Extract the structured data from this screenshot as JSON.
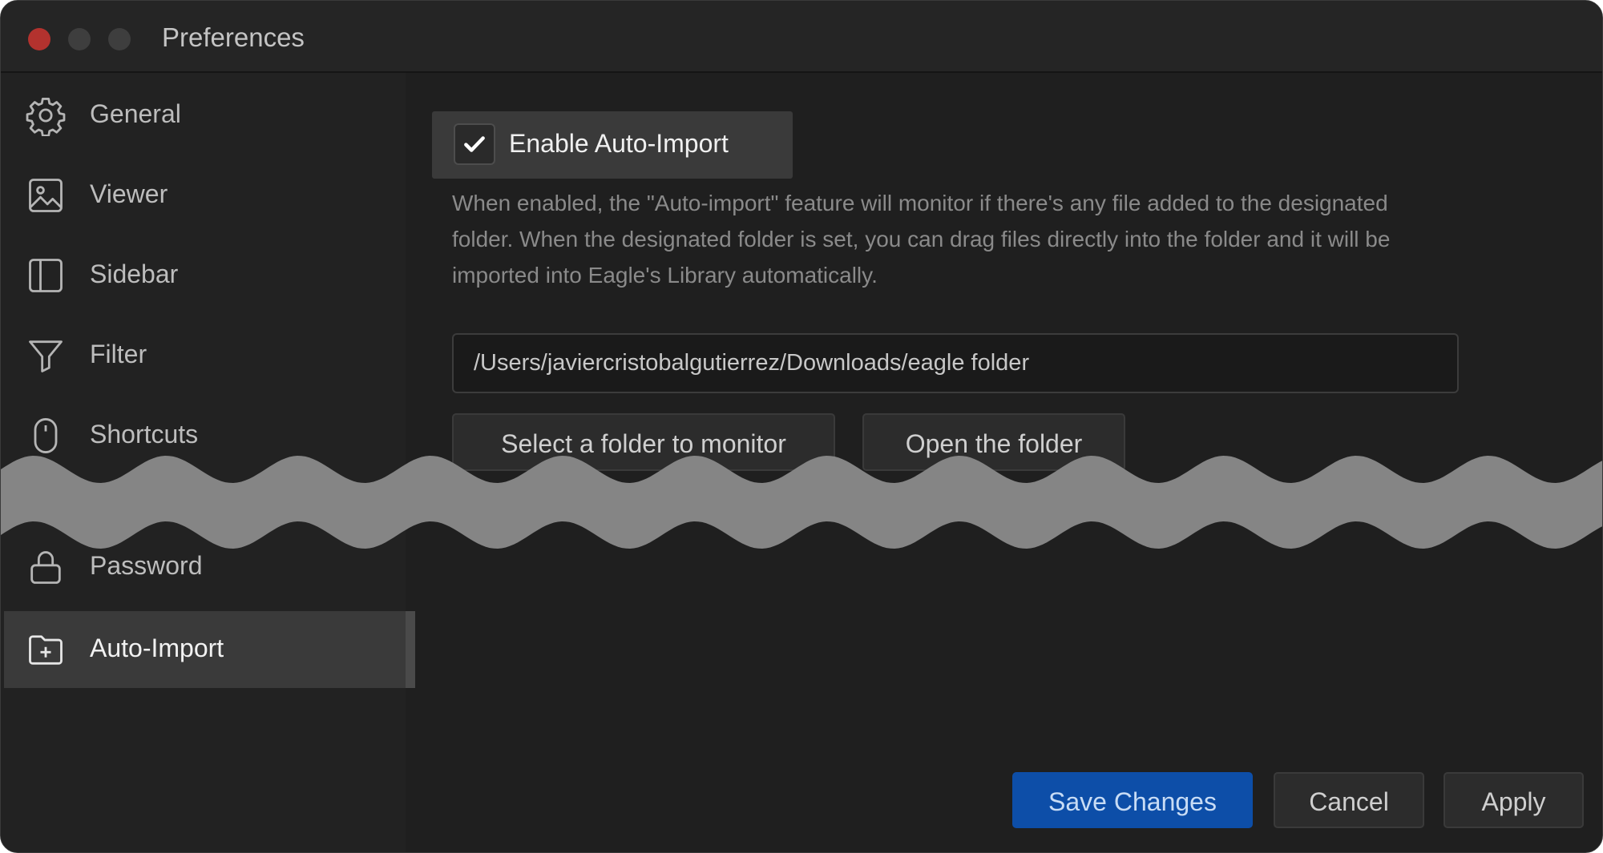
{
  "window": {
    "title": "Preferences"
  },
  "sidebar": {
    "items": [
      {
        "label": "General",
        "icon": "gear-icon"
      },
      {
        "label": "Viewer",
        "icon": "image-icon"
      },
      {
        "label": "Sidebar",
        "icon": "sidebar-icon"
      },
      {
        "label": "Filter",
        "icon": "filter-icon"
      },
      {
        "label": "Shortcuts",
        "icon": "mouse-icon"
      },
      {
        "label": "Password",
        "icon": "lock-icon"
      },
      {
        "label": "Auto-Import",
        "icon": "folder-plus-icon",
        "active": true
      }
    ]
  },
  "auto_import": {
    "enable_label": "Enable Auto-Import",
    "enabled": true,
    "description": "When enabled, the \"Auto-import\" feature will monitor if there's any file added to the designated folder. When the designated folder is set, you can drag files directly into the folder and it will be imported into Eagle's Library automatically.",
    "folder_path": "/Users/javiercristobalgutierrez/Downloads/eagle folder",
    "select_folder_label": "Select a folder to monitor",
    "open_folder_label": "Open the folder"
  },
  "footer": {
    "save_label": "Save Changes",
    "cancel_label": "Cancel",
    "apply_label": "Apply"
  },
  "colors": {
    "accent": "#0d4ea8",
    "close_button": "#b3322e",
    "background": "#1f1f1f"
  }
}
